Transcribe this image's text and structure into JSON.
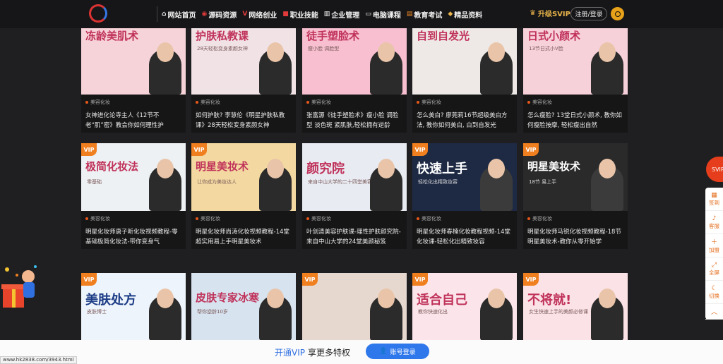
{
  "nav": {
    "items": [
      {
        "icon": "home-icon",
        "glyph": "⌂",
        "label": "网站首页",
        "color": "#ffffff"
      },
      {
        "icon": "source-icon",
        "glyph": "◉",
        "label": "源码资源",
        "color": "#e33b3b"
      },
      {
        "icon": "v-icon",
        "glyph": "V",
        "label": "网络创业",
        "color": "#e33b3b"
      },
      {
        "icon": "briefcase-icon",
        "glyph": "■",
        "label": "职业技能",
        "color": "#e33b3b"
      },
      {
        "icon": "chart-icon",
        "glyph": "▥",
        "label": "企业管理",
        "color": "#ffffff"
      },
      {
        "icon": "monitor-icon",
        "glyph": "▭",
        "label": "电脑课程",
        "color": "#ffffff"
      },
      {
        "icon": "book-icon",
        "glyph": "▤",
        "label": "教育考试",
        "color": "#f08a24"
      },
      {
        "icon": "diamond-icon",
        "glyph": "◆",
        "label": "精品资料",
        "color": "#e8b34a"
      }
    ],
    "vip_label": "升级SVIP",
    "login_label": "注册/登录"
  },
  "cards": [
    {
      "vip": false,
      "bg": "#f6d3d8",
      "big": "冻龄美肌术",
      "sub": "",
      "title": "女神进化论寺主人《12节不老“肌”密》教会你如何理性护",
      "category": "美容化妆",
      "time": "2年前",
      "views": "28",
      "score": "8.3"
    },
    {
      "vip": false,
      "bg": "#f1e2e6",
      "big": "护肤私教课",
      "sub": "28天轻松变身素颜女神",
      "title": "如何护肤? 李慧伦《明星护肤私教课》28天轻松变身素颜女神",
      "category": "美容化妆",
      "time": "2年前",
      "views": "23",
      "score": "8.3"
    },
    {
      "vip": false,
      "bg": "#f7bfd0",
      "big": "徒手塑脸术",
      "sub": "瘦小脸 调脸型",
      "title": "张富源《徒手塑脸术》瘦小脸 调脸型 淡色斑 紧肌肤,轻松拥有逆龄",
      "category": "美容化妆",
      "time": "2年前",
      "views": "30",
      "score": "8.3"
    },
    {
      "vip": false,
      "bg": "#eee9e6",
      "big": "自到自发光",
      "sub": "",
      "title": "怎么美白? 廖莞莉16节超级美白方法, 教你如何美白, 白到自发光",
      "category": "美容化妆",
      "time": "2年前",
      "views": "40",
      "score": "8.3"
    },
    {
      "vip": false,
      "bg": "#f7d1da",
      "big": "日式小颜术",
      "sub": "13节日式小V脸",
      "title": "怎么瘦脸? 13堂日式小颜术, 教你如何瘦脸按摩, 轻松瘦出自然",
      "category": "美容化妆",
      "time": "2年前",
      "views": "36",
      "score": "8.3"
    },
    {
      "vip": true,
      "bg": "#eef1f4",
      "big": "极简化妆法",
      "sub": "零基础",
      "title": "明星化妆师唐子昕化妆视频教程-零基础极简化妆法-带你变身气",
      "category": "美容化妆",
      "time": "2年前",
      "views": "25",
      "score": "8.3"
    },
    {
      "vip": true,
      "bg": "#f3d9a1",
      "big": "明星美妆术",
      "sub": "让你成为美妆达人",
      "title": "明星化妆师尚涛化妆视频教程-14堂超实用易上手明星美妆术",
      "category": "美容化妆",
      "time": "2年前",
      "views": "22",
      "score": "8.3"
    },
    {
      "vip": false,
      "bg": "#e8ebf2",
      "big": "颜究院",
      "sub": "来自中山大学的二十四堂美容课",
      "title": "叶剑清美容护肤课-理性护肤颜究院-来自中山大学的24堂美颜秘笈",
      "category": "美容化妆",
      "time": "2年前",
      "views": "22",
      "score": "8.3"
    },
    {
      "vip": true,
      "bg": "#1e2a44",
      "big": "快速上手",
      "sub": "轻松化出精致妆容",
      "title": "明星化妆师春楠化妆教程视频-14堂化妆课-轻松化出精致妆容",
      "category": "美容化妆",
      "time": "2年前",
      "views": "26",
      "score": "8.3"
    },
    {
      "vip": true,
      "bg": "#2a2a2a",
      "big": "明星美妆术",
      "sub": "18节 易上手",
      "title": "明星化妆师马锐化妆视频教程-18节明星美妆术-教你从零开始学",
      "category": "美容化妆",
      "time": "2年前",
      "views": "28",
      "score": "8.3"
    },
    {
      "vip": true,
      "bg": "#eef4fb",
      "big": "美肤处方",
      "sub": "皮肤博士",
      "title": "",
      "category": "",
      "time": "",
      "views": "",
      "score": ""
    },
    {
      "vip": false,
      "bg": "#d7e3ef",
      "big": "皮肤专家冰寒",
      "sub": "帮你逆龄10岁",
      "title": "",
      "category": "",
      "time": "",
      "views": "",
      "score": ""
    },
    {
      "vip": true,
      "bg": "#e7d8cf",
      "big": "",
      "sub": "",
      "title": "",
      "category": "",
      "time": "",
      "views": "",
      "score": ""
    },
    {
      "vip": true,
      "bg": "#fbe5ea",
      "big": "适合自己",
      "sub": "教你快速化出",
      "title": "",
      "category": "",
      "time": "",
      "views": "",
      "score": ""
    },
    {
      "vip": true,
      "bg": "#fbe2e6",
      "big": "不将就!",
      "sub": "女生快速上手的美颜必修课",
      "title": "",
      "category": "",
      "time": "",
      "views": "",
      "score": ""
    }
  ],
  "side": {
    "sign_label": "SVIP",
    "items": [
      {
        "icon": "calendar-icon",
        "glyph": "▦",
        "label": "签到"
      },
      {
        "icon": "bell-icon",
        "glyph": "♪",
        "label": "客服"
      },
      {
        "icon": "plus-icon",
        "glyph": "＋",
        "label": "加盟"
      },
      {
        "icon": "fullscreen-icon",
        "glyph": "⤢",
        "label": "全屏"
      },
      {
        "icon": "moon-icon",
        "glyph": "☾",
        "label": "切换"
      },
      {
        "icon": "chevron-up-icon",
        "glyph": "︿",
        "label": ""
      }
    ]
  },
  "bottom": {
    "open_vip": "开通VIP",
    "privilege": "享更多特权",
    "account_btn": "账号登录"
  },
  "status_url": "www.hk2838.com/3943.html"
}
